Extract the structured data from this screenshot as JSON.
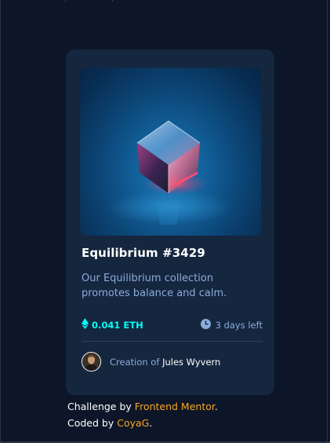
{
  "card": {
    "title": "Equilibrium #3429",
    "description": "Our Equilibrium collection promotes balance and calm.",
    "price": "0.041 ETH",
    "time_left": "3 days left",
    "creator_prefix": "Creation of",
    "creator_name": "Jules Wyvern"
  },
  "attribution": {
    "line1_prefix": "Challenge by",
    "line1_link": "Frontend Mentor",
    "line1_suffix": ".",
    "line2_prefix": "Coded by",
    "line2_link": "CoyaG",
    "line2_suffix": "."
  },
  "colors": {
    "page_background": "#0d1628",
    "card_background": "#15263f",
    "accent_cyan": "#00fff8",
    "soft_blue_text": "#8bacda",
    "link_orange": "#f5a623",
    "divider": "#2e405a"
  },
  "icons": {
    "eth": "ethereum-icon",
    "clock": "clock-icon",
    "avatar": "avatar-image",
    "hero": "equilibrium-cube-image"
  }
}
